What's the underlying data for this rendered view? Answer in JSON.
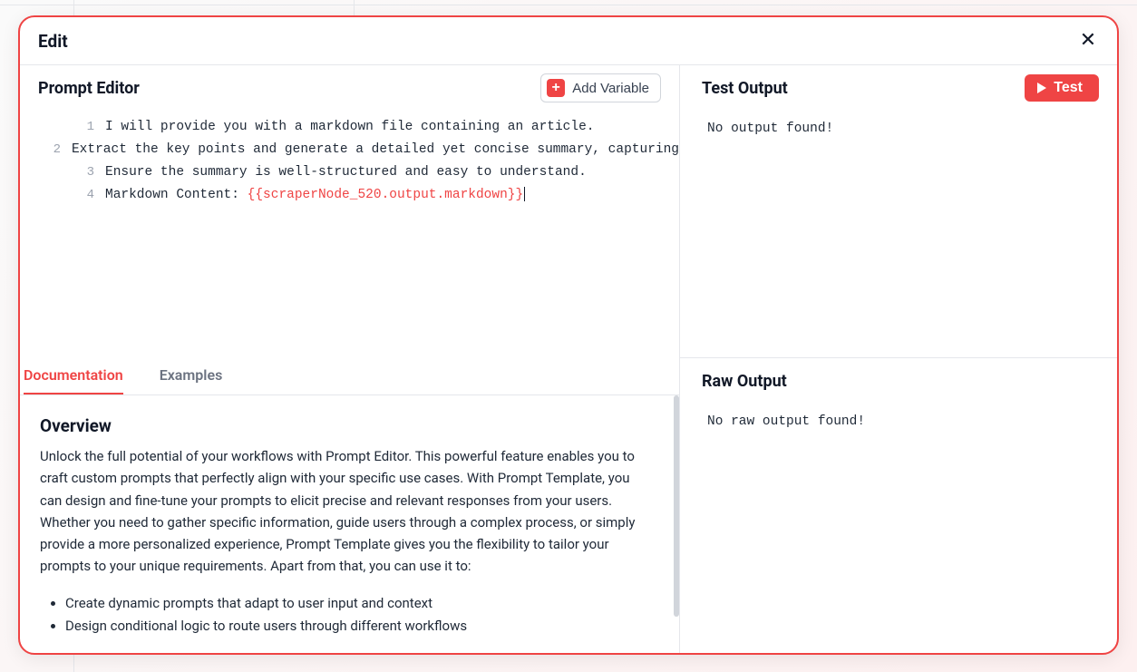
{
  "modal": {
    "title": "Edit"
  },
  "promptEditor": {
    "title": "Prompt Editor",
    "addVariableLabel": "Add Variable",
    "lines": [
      {
        "num": "1",
        "text": "I will provide you with a markdown file containing an article."
      },
      {
        "num": "2",
        "text": "Extract the key points and generate a detailed yet concise summary, capturing"
      },
      {
        "num": "3",
        "text": "Ensure the summary is well-structured and easy to understand."
      },
      {
        "num": "4",
        "text": "Markdown Content: ",
        "variable": "{{scraperNode_520.output.markdown}}"
      }
    ]
  },
  "tabs": {
    "documentation": "Documentation",
    "examples": "Examples"
  },
  "documentation": {
    "heading": "Overview",
    "paragraph": "Unlock the full potential of your workflows with Prompt Editor. This powerful feature enables you to craft custom prompts that perfectly align with your specific use cases. With Prompt Template, you can design and fine-tune your prompts to elicit precise and relevant responses from your users. Whether you need to gather specific information, guide users through a complex process, or simply provide a more personalized experience, Prompt Template gives you the flexibility to tailor your prompts to your unique requirements. Apart from that, you can use it to:",
    "bullets": [
      "Create dynamic prompts that adapt to user input and context",
      "Design conditional logic to route users through different workflows"
    ]
  },
  "testOutput": {
    "title": "Test Output",
    "buttonLabel": "Test",
    "message": "No output found!"
  },
  "rawOutput": {
    "title": "Raw Output",
    "message": "No raw output found!"
  }
}
